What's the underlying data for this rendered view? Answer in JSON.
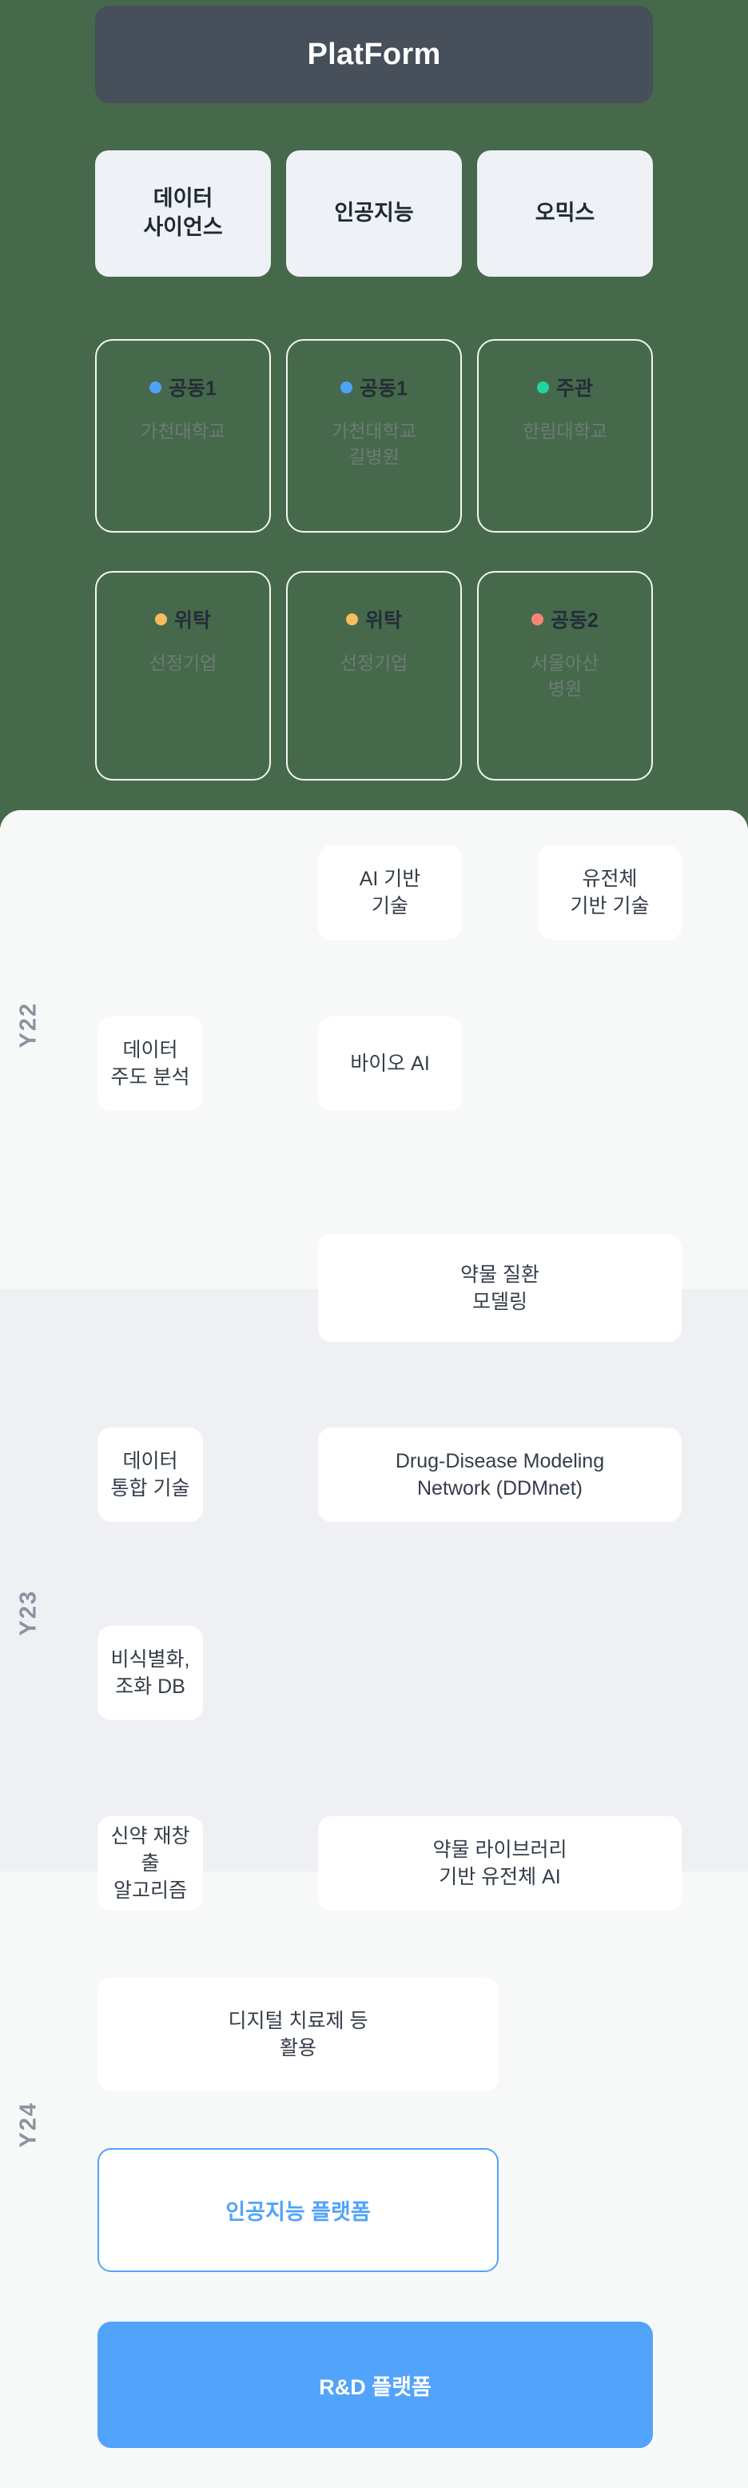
{
  "header": {
    "title": "PlatForm"
  },
  "domains": [
    {
      "label": "데이터\n사이언스"
    },
    {
      "label": "인공지능"
    },
    {
      "label": "오믹스"
    }
  ],
  "partners": {
    "row1": [
      {
        "role": "공동1",
        "dot_color": "#4ea2f7",
        "org": "가천대학교"
      },
      {
        "role": "공동1",
        "dot_color": "#4ea2f7",
        "org": "가천대학교\n길병원"
      },
      {
        "role": "주관",
        "dot_color": "#1fd6a0",
        "org": "한림대학교"
      }
    ],
    "row2": [
      {
        "role": "위탁",
        "dot_color": "#f9bd5e",
        "org": "선정기업"
      },
      {
        "role": "위탁",
        "dot_color": "#f9bd5e",
        "org": "선정기업"
      },
      {
        "role": "공동2",
        "dot_color": "#fb8575",
        "org": "서울아산\n병원"
      }
    ]
  },
  "years": {
    "y22": {
      "label": "Y22"
    },
    "y23": {
      "label": "Y23"
    },
    "y24": {
      "label": "Y24"
    }
  },
  "tasks": [
    {
      "id": "t1",
      "year": "Y22",
      "label": "AI 기반\n기술"
    },
    {
      "id": "t2",
      "year": "Y22",
      "label": "유전체\n기반 기술"
    },
    {
      "id": "t3",
      "year": "Y22",
      "label": "데이터\n주도 분석"
    },
    {
      "id": "t4",
      "year": "Y22",
      "label": "바이오 AI"
    },
    {
      "id": "t5",
      "year": "Y23",
      "label": "약물 질환\n모델링"
    },
    {
      "id": "t6",
      "year": "Y23",
      "label": "데이터\n통합 기술"
    },
    {
      "id": "t7",
      "year": "Y23",
      "label": "Drug-Disease Modeling\nNetwork (DDMnet)"
    },
    {
      "id": "t8",
      "year": "Y23",
      "label": "비식별화,\n조화 DB"
    },
    {
      "id": "t9",
      "year": "Y24",
      "label": "신약 재창출\n알고리즘"
    },
    {
      "id": "t10",
      "year": "Y24",
      "label": "약물 라이브러리\n기반 유전체 AI"
    },
    {
      "id": "t11",
      "year": "Y24",
      "label": "디지털 치료제 등\n활용"
    }
  ],
  "platform_buttons": {
    "ai_platform": "인공지능 플랫폼",
    "rnd_platform": "R&D 플랫폼"
  },
  "colors": {
    "green_background": "#47694b",
    "header_dark": "#464f5a",
    "accent_blue": "#52a3fb",
    "band_light": "#f7f9f8",
    "band_gray": "#eef0f4"
  }
}
